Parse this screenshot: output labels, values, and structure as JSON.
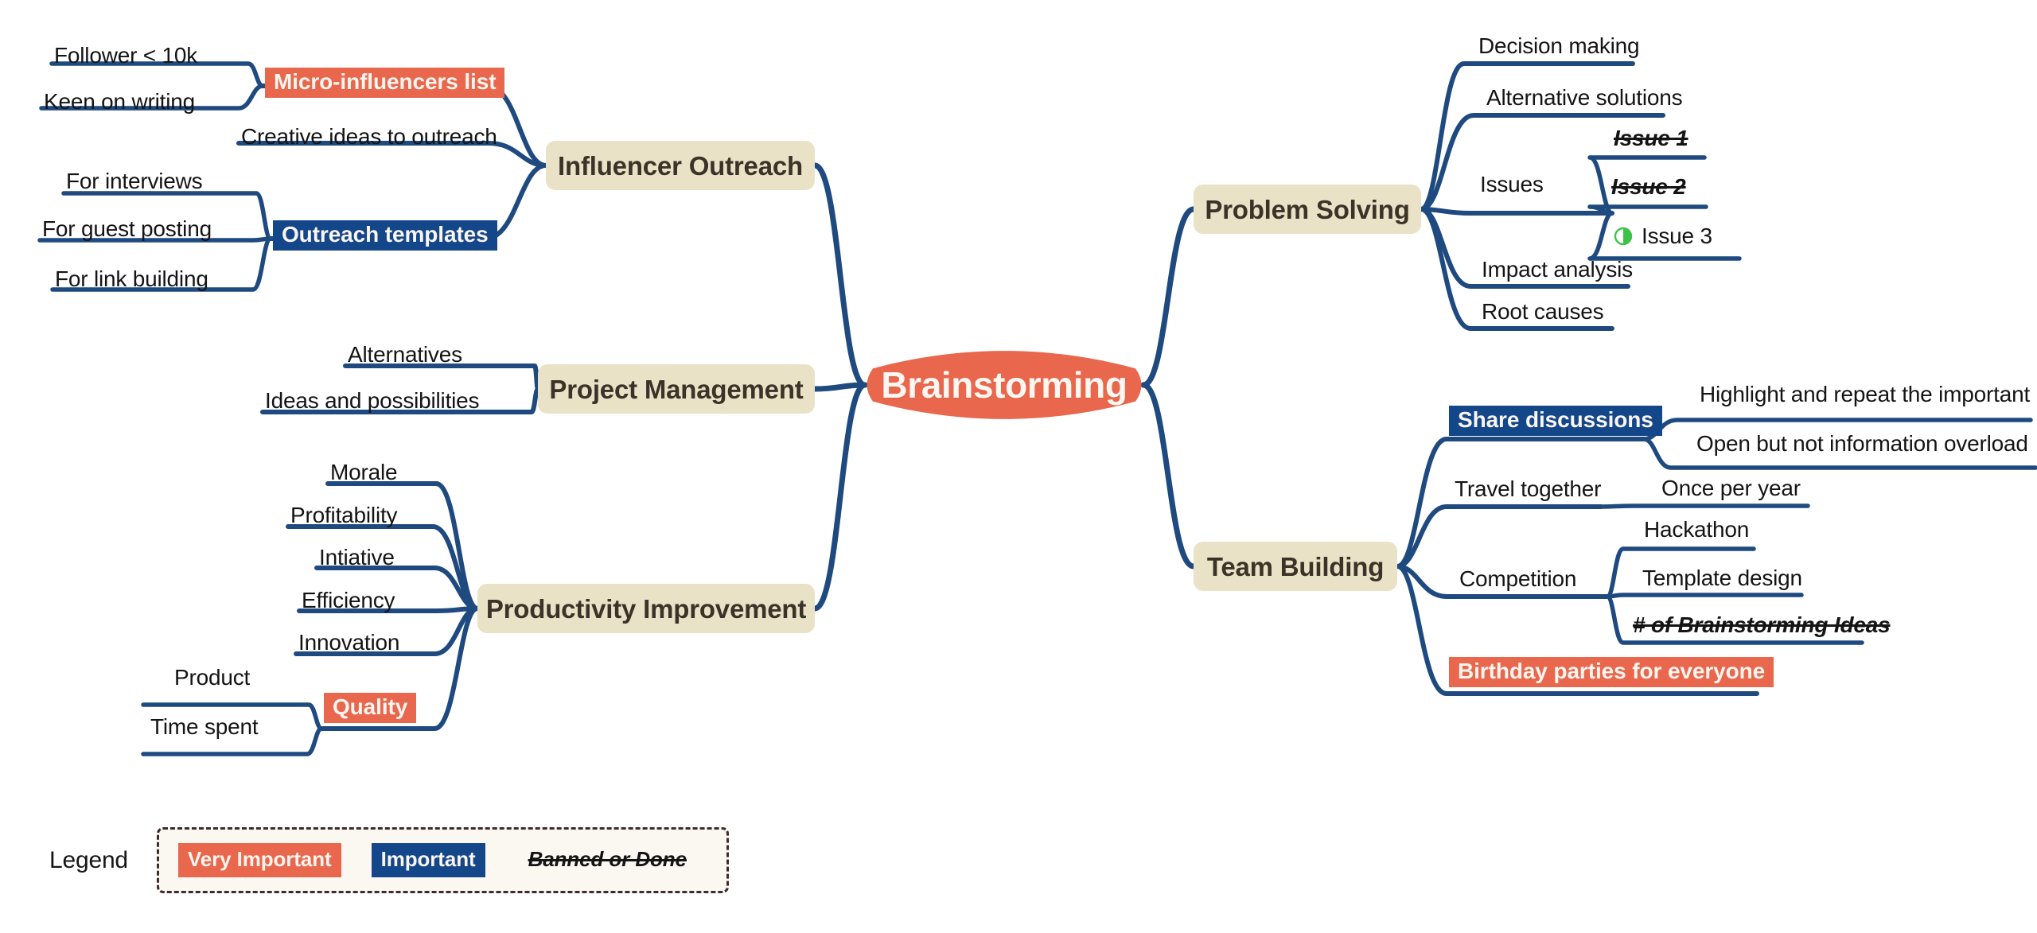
{
  "colors": {
    "central_fill": "#e8674d",
    "main_topic_fill": "#eae2c6",
    "branch_stroke": "#1f4a80",
    "very_important": "#e8674d",
    "important": "#14468a",
    "progress_green": "#3cc24a",
    "page_background": "#ffffff"
  },
  "central": {
    "label": "Brainstorming"
  },
  "legend": {
    "title": "Legend",
    "items": [
      {
        "label": "Very Important",
        "style": "orange"
      },
      {
        "label": "Important",
        "style": "blue"
      },
      {
        "label": "Banned or Done",
        "style": "strike"
      }
    ]
  },
  "branches": [
    {
      "id": "influencer-outreach",
      "label": "Influencer Outreach",
      "side": "left",
      "children": [
        {
          "label": "Micro-influencers list",
          "style": "orange",
          "children": [
            {
              "label": "Follower < 10k",
              "style": "plain"
            },
            {
              "label": "Keen on writing",
              "style": "plain"
            }
          ]
        },
        {
          "label": "Creative ideas to outreach",
          "style": "plain",
          "children": []
        },
        {
          "label": "Outreach templates",
          "style": "blue",
          "children": [
            {
              "label": "For interviews",
              "style": "plain"
            },
            {
              "label": "For guest posting",
              "style": "plain"
            },
            {
              "label": "For link building",
              "style": "plain"
            }
          ]
        }
      ]
    },
    {
      "id": "project-management",
      "label": "Project Management",
      "side": "left",
      "children": [
        {
          "label": "Alternatives",
          "style": "plain",
          "children": []
        },
        {
          "label": "Ideas and possibilities",
          "style": "plain",
          "children": []
        }
      ]
    },
    {
      "id": "productivity-improvement",
      "label": "Productivity Improvement",
      "side": "left",
      "children": [
        {
          "label": "Morale",
          "style": "plain",
          "children": []
        },
        {
          "label": "Profitability",
          "style": "plain",
          "children": []
        },
        {
          "label": "Intiative",
          "style": "plain",
          "children": []
        },
        {
          "label": "Efficiency",
          "style": "plain",
          "children": []
        },
        {
          "label": "Innovation",
          "style": "plain",
          "children": []
        },
        {
          "label": "Quality",
          "style": "orange",
          "children": [
            {
              "label": "Product",
              "style": "plain"
            },
            {
              "label": "Time spent",
              "style": "plain"
            }
          ]
        }
      ]
    },
    {
      "id": "problem-solving",
      "label": "Problem Solving",
      "side": "right",
      "children": [
        {
          "label": "Decision making",
          "style": "plain",
          "children": []
        },
        {
          "label": "Alternative solutions",
          "style": "plain",
          "children": []
        },
        {
          "label": "Issues",
          "style": "plain",
          "children": [
            {
              "label": "Issue 1",
              "style": "strike"
            },
            {
              "label": "Issue 2",
              "style": "strike"
            },
            {
              "label": "Issue 3",
              "style": "plain",
              "icon": "progress-half-icon",
              "progress": 50
            }
          ]
        },
        {
          "label": "Impact analysis",
          "style": "plain",
          "children": []
        },
        {
          "label": "Root causes",
          "style": "plain",
          "children": []
        }
      ]
    },
    {
      "id": "team-building",
      "label": "Team Building",
      "side": "right",
      "children": [
        {
          "label": "Share discussions",
          "style": "blue",
          "children": [
            {
              "label": "Highlight and repeat the important",
              "style": "plain"
            },
            {
              "label": "Open but not information overload",
              "style": "plain"
            }
          ]
        },
        {
          "label": "Travel together",
          "style": "plain",
          "children": [
            {
              "label": "Once per year",
              "style": "plain"
            }
          ]
        },
        {
          "label": "Competition",
          "style": "plain",
          "children": [
            {
              "label": "Hackathon",
              "style": "plain"
            },
            {
              "label": "Template design",
              "style": "plain"
            },
            {
              "label": "# of Brainstorming Ideas",
              "style": "strike"
            }
          ]
        },
        {
          "label": "Birthday parties for everyone",
          "style": "orange",
          "children": []
        }
      ]
    }
  ]
}
